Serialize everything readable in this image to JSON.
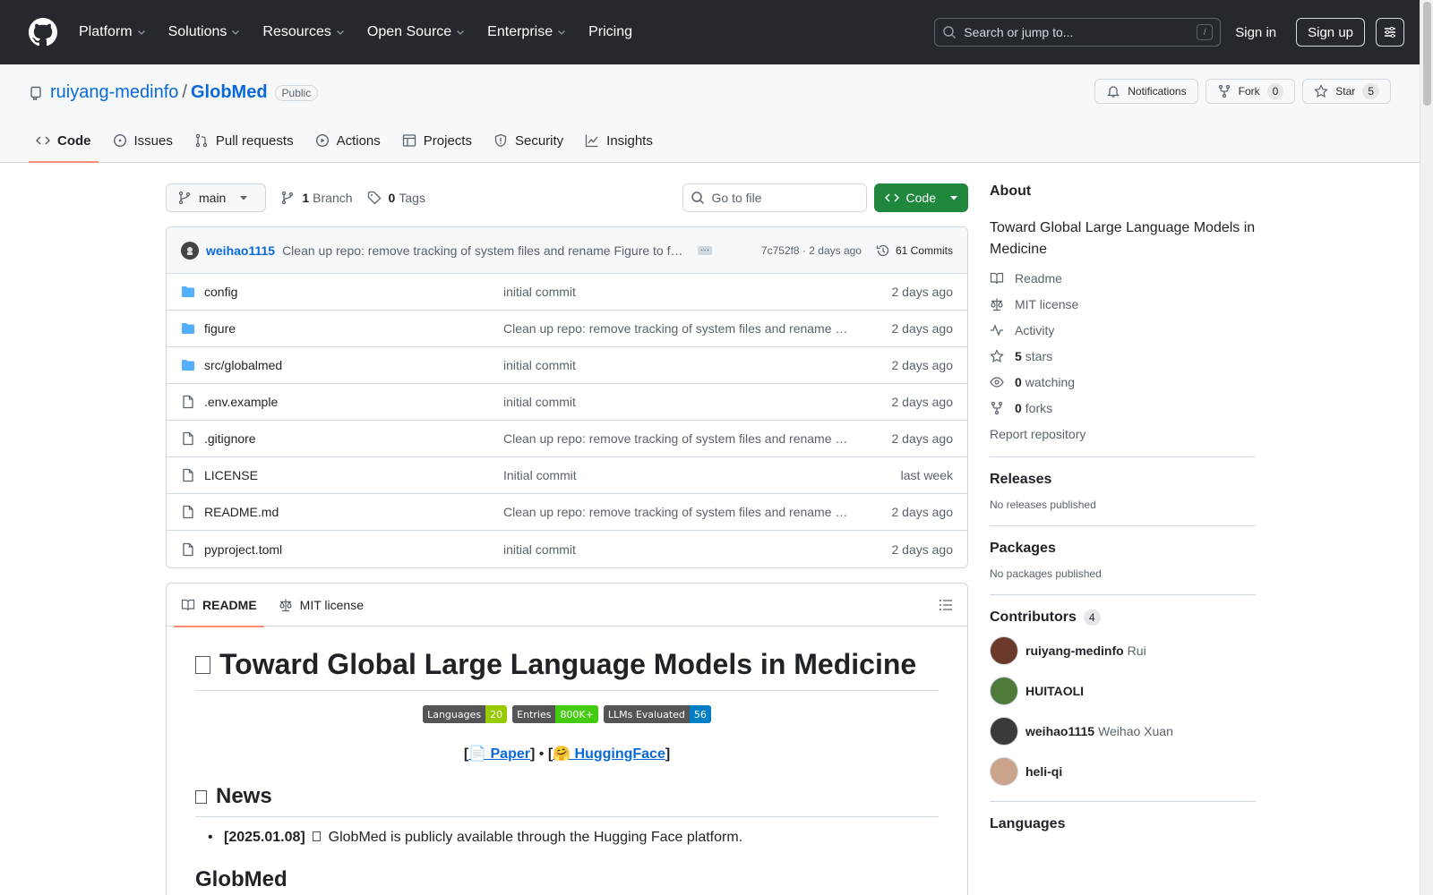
{
  "header": {
    "nav": [
      "Platform",
      "Solutions",
      "Resources",
      "Open Source",
      "Enterprise",
      "Pricing"
    ],
    "search_placeholder": "Search or jump to...",
    "search_shortcut": "/",
    "signin": "Sign in",
    "signup": "Sign up"
  },
  "repo": {
    "owner": "ruiyang-medinfo",
    "separator": "/",
    "name": "GlobMed",
    "visibility": "Public",
    "notifications": "Notifications",
    "fork_label": "Fork",
    "fork_count": "0",
    "star_label": "Star",
    "star_count": "5",
    "tabs": [
      "Code",
      "Issues",
      "Pull requests",
      "Actions",
      "Projects",
      "Security",
      "Insights"
    ]
  },
  "toolbar": {
    "branch": "main",
    "branch_count": "1",
    "branch_label": "Branch",
    "tag_count": "0",
    "tag_label": "Tags",
    "goto_placeholder": "Go to file",
    "code_button": "Code"
  },
  "latest_commit": {
    "author": "weihao1115",
    "message": "Clean up repo: remove tracking of system files and rename Figure to figure",
    "sha_time": "7c752f8 · 2 days ago",
    "commits": "61 Commits"
  },
  "files": [
    {
      "type": "dir",
      "name": "config",
      "message": "initial commit",
      "date": "2 days ago"
    },
    {
      "type": "dir",
      "name": "figure",
      "message": "Clean up repo: remove tracking of system files and rename Figure to figure",
      "date": "2 days ago"
    },
    {
      "type": "dir",
      "name": "src/globalmed",
      "message": "initial commit",
      "date": "2 days ago"
    },
    {
      "type": "file",
      "name": ".env.example",
      "message": "initial commit",
      "date": "2 days ago"
    },
    {
      "type": "file",
      "name": ".gitignore",
      "message": "Clean up repo: remove tracking of system files and rename Figure to figure",
      "date": "2 days ago"
    },
    {
      "type": "file",
      "name": "LICENSE",
      "message": "Initial commit",
      "date": "last week"
    },
    {
      "type": "file",
      "name": "README.md",
      "message": "Clean up repo: remove tracking of system files and rename Figure to figure",
      "date": "2 days ago"
    },
    {
      "type": "file",
      "name": "pyproject.toml",
      "message": "initial commit",
      "date": "2 days ago"
    }
  ],
  "readme": {
    "tab_readme": "README",
    "tab_license": "MIT license",
    "title": "Toward Global Large Language Models in Medicine",
    "badges": [
      {
        "label": "Languages",
        "value": "20",
        "color": "#97ca00"
      },
      {
        "label": "Entries",
        "value": "800K+",
        "color": "#4c1"
      },
      {
        "label": "LLMs Evaluated",
        "value": "56",
        "color": "#007ec6"
      }
    ],
    "link_open1": "[",
    "link_paper": "📄 Paper",
    "link_close1": "]",
    "link_dot": " • ",
    "link_open2": "[",
    "link_hf": "🤗 HuggingFace",
    "link_close2": "]",
    "news_heading": "News",
    "news_date": "[2025.01.08]",
    "news_text": "GlobMed is publicly available through the Hugging Face platform.",
    "next_heading": "GlobMed"
  },
  "sidebar": {
    "about_heading": "About",
    "description": "Toward Global Large Language Models in Medicine",
    "readme": "Readme",
    "license": "MIT license",
    "activity": "Activity",
    "stars_count": "5",
    "stars_label": "stars",
    "watching_count": "0",
    "watching_label": "watching",
    "forks_count": "0",
    "forks_label": "forks",
    "report": "Report repository",
    "releases_heading": "Releases",
    "releases_text": "No releases published",
    "packages_heading": "Packages",
    "packages_text": "No packages published",
    "contributors_heading": "Contributors",
    "contributors_count": "4",
    "contributors": [
      {
        "login": "ruiyang-medinfo",
        "name": "Rui",
        "color": "#6b3a2a"
      },
      {
        "login": "HUITAOLI",
        "name": "",
        "color": "#4f7a3a"
      },
      {
        "login": "weihao1115",
        "name": "Weihao Xuan",
        "color": "#3a3a3a"
      },
      {
        "login": "heli-qi",
        "name": "",
        "color": "#c9a38a"
      }
    ],
    "languages_heading": "Languages"
  },
  "colors": {
    "accent": "#0969da",
    "green": "#1f883d",
    "header_bg": "#25292e",
    "tab_underline": "#fd8c73"
  }
}
